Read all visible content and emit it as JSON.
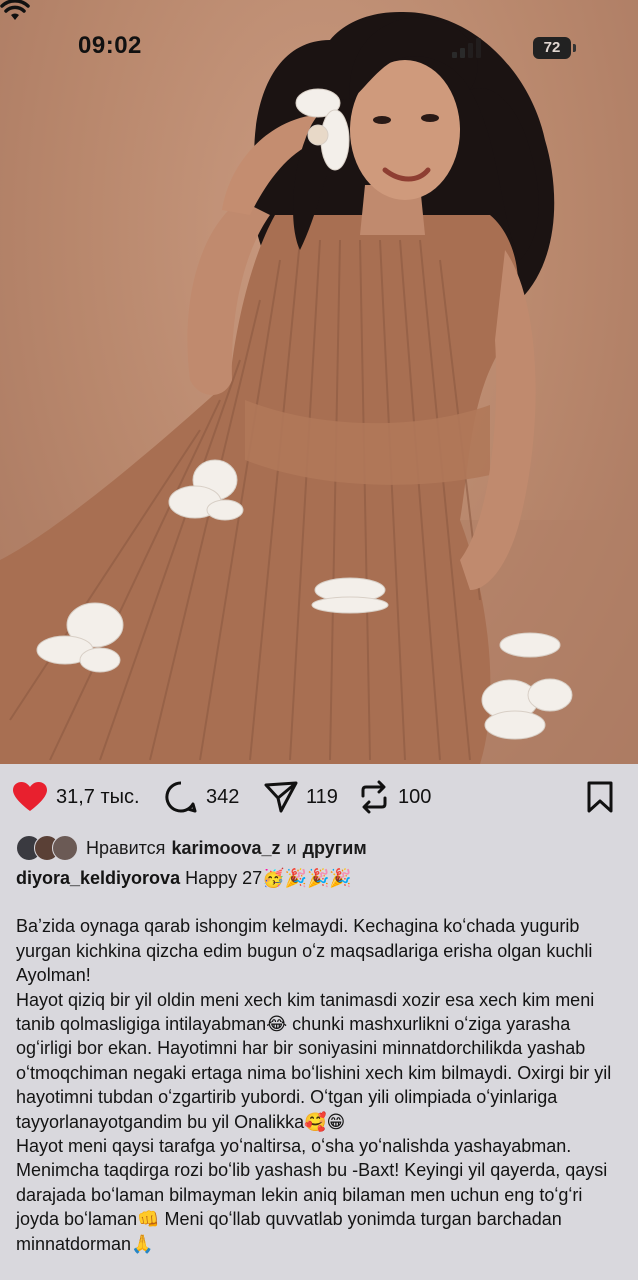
{
  "status_bar": {
    "time": "09:02",
    "battery": "72"
  },
  "photo": {
    "description_icon": "photo"
  },
  "actions": {
    "likes": "31,7 тыс.",
    "comments": "342",
    "shares": "119",
    "reposts": "100"
  },
  "liked_by": {
    "prefix": "Нравится",
    "user": "karimoova_z",
    "joiner": "и",
    "others": "другим"
  },
  "post": {
    "username": "diyora_keldiyorova",
    "headline": "Happy 27🥳🎉🎉🎉",
    "paragraphs": [
      "Baʼzida oynaga qarab ishongim kelmaydi. Kechagina koʻchada yugurib yurgan kichkina qizcha edim bugun oʻz maqsadlariga erisha olgan kuchli Ayolman!",
      "Hayot qiziq bir yil oldin meni xech kim tanimasdi xozir esa xech kim meni tanib qolmasligiga intilayabman😂 chunki mashxurlikni oʻziga yarasha ogʻirligi bor ekan. Hayotimni har bir soniyasini minnatdorchilikda yashab oʻtmoqchiman negaki ertaga nima boʻlishini xech kim bilmaydi. Oxirgi bir yil hayotimni tubdan oʻzgartirib yubordi. Oʻtgan yili olimpiada oʻyinlariga tayyorlanayotgandim bu yil Onalikka🥰😁",
      "Hayot meni qaysi tarafga yoʻnaltirsa, oʻsha yoʻnalishda yashayabman. Menimcha taqdirga rozi boʻlib yashash bu -Baxt! Keyingi yil qayerda, qaysi darajada boʻlaman bilmayman lekin aniq bilaman men uchun eng toʻgʻri joyda boʻlaman👊 Meni qoʻllab quvvatlab yonimda turgan barchadan minnatdorman🙏"
    ]
  },
  "colors": {
    "heart": "#e8202e",
    "background": "#d9d8dd",
    "photo_bg": "#b8876c"
  }
}
